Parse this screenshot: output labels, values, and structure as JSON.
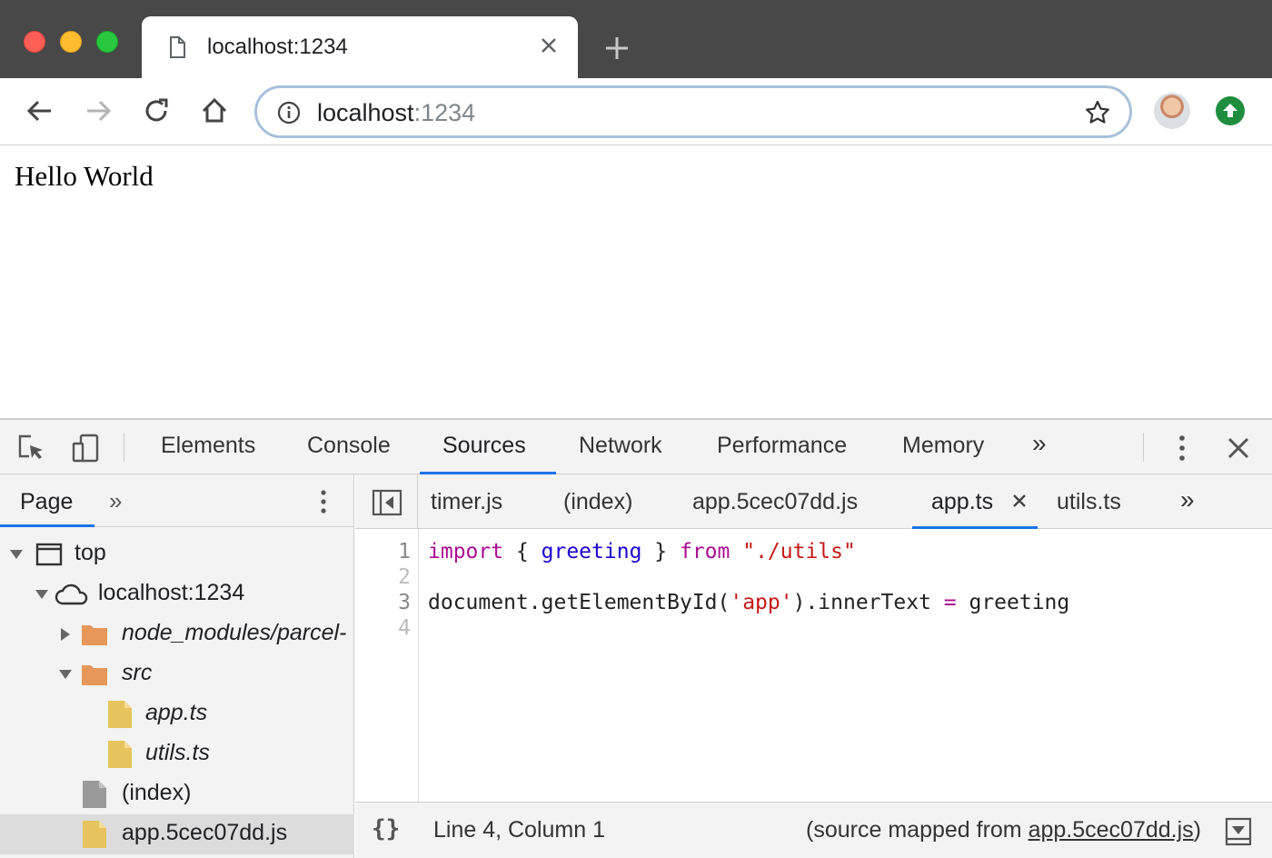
{
  "browser": {
    "tab_title": "localhost:1234",
    "url_host": "localhost",
    "url_port": ":1234",
    "page_text": "Hello World"
  },
  "devtools": {
    "tabs": [
      "Elements",
      "Console",
      "Sources",
      "Network",
      "Performance",
      "Memory"
    ],
    "active_tab": "Sources",
    "more_tabs": "»",
    "navigator": {
      "header": "Page",
      "more": "»",
      "tree": [
        {
          "label": "top",
          "italic": false,
          "icon": "frame-icon",
          "expanded": true
        },
        {
          "label": "localhost:1234",
          "italic": false,
          "icon": "cloud-icon",
          "expanded": true
        },
        {
          "label": "node_modules/parcel-",
          "italic": true,
          "icon": "folder-icon",
          "expanded": false
        },
        {
          "label": "src",
          "italic": true,
          "icon": "folder-icon",
          "expanded": true
        },
        {
          "label": "app.ts",
          "italic": true,
          "icon": "ts-file-icon"
        },
        {
          "label": "utils.ts",
          "italic": true,
          "icon": "ts-file-icon"
        },
        {
          "label": "(index)",
          "italic": false,
          "icon": "document-icon"
        },
        {
          "label": "app.5cec07dd.js",
          "italic": false,
          "icon": "js-file-icon",
          "selected": true
        }
      ]
    },
    "editor": {
      "tabs": [
        "timer.js",
        "(index)",
        "app.5cec07dd.js",
        "app.ts",
        "utils.ts"
      ],
      "active_tab": "app.ts",
      "more": "»",
      "lines": [
        {
          "num": "1",
          "tokens": [
            {
              "t": "import",
              "c": "kw"
            },
            {
              "t": " { ",
              "c": ""
            },
            {
              "t": "greeting",
              "c": "var"
            },
            {
              "t": " } ",
              "c": ""
            },
            {
              "t": "from",
              "c": "kw"
            },
            {
              "t": " ",
              "c": ""
            },
            {
              "t": "\"./utils\"",
              "c": "str"
            }
          ]
        },
        {
          "num": "2",
          "tokens": []
        },
        {
          "num": "3",
          "tokens": [
            {
              "t": "document.getElementById(",
              "c": ""
            },
            {
              "t": "'app'",
              "c": "str"
            },
            {
              "t": ").innerText ",
              "c": ""
            },
            {
              "t": "=",
              "c": "op"
            },
            {
              "t": " greeting",
              "c": ""
            }
          ]
        },
        {
          "num": "4",
          "tokens": []
        }
      ]
    },
    "status": {
      "braces": "{}",
      "position": "Line 4, Column 1",
      "mapped_prefix": "(source mapped from ",
      "mapped_link": "app.5cec07dd.js",
      "mapped_suffix": ")"
    }
  },
  "colors": {
    "tab_strip": "#484848",
    "accent": "#1a73e8",
    "folder": "#e8975a",
    "ts_file": "#e6c35c",
    "keyword": "#aa0d91",
    "string": "#c41a16",
    "variable": "#1c00cf"
  }
}
